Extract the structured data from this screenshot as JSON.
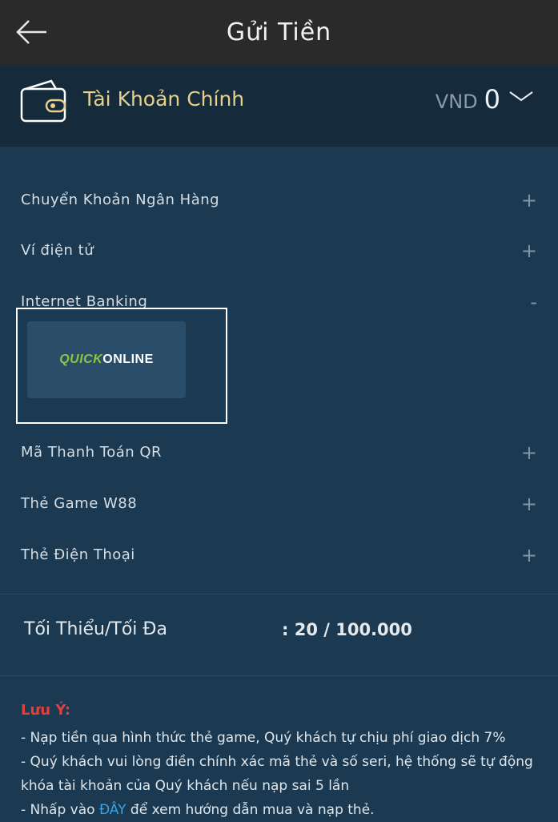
{
  "header": {
    "title": "Gửi Tiền",
    "back_icon": "arrow-left-icon"
  },
  "account": {
    "name": "Tài Khoản Chính",
    "currency": "VND",
    "balance": "0",
    "wallet_icon": "wallet-icon",
    "expand_icon": "chevron-down-icon"
  },
  "menu": {
    "items": [
      {
        "label": "Chuyển Khoản Ngân Hàng",
        "sign": "+"
      },
      {
        "label": "Ví điện tử",
        "sign": "+"
      },
      {
        "label": "Internet Banking",
        "sign": "-"
      },
      {
        "label": "Mã Thanh Toán QR",
        "sign": "+"
      },
      {
        "label": "Thẻ Game W88",
        "sign": "+"
      },
      {
        "label": "Thẻ Điện Thoại",
        "sign": "+"
      }
    ],
    "internet_banking_option": {
      "logo_part1": "QUICK",
      "logo_part2": "ONLINE"
    }
  },
  "limits": {
    "label": "Tối Thiểu/Tối Đa",
    "value": ": 20 / 100.000"
  },
  "notes": {
    "title": "Lưu Ý:",
    "line1": "- Nạp tiền qua hình thức thẻ game, Quý khách tự chịu phí giao dịch 7%",
    "line2": "- Quý khách vui lòng điền chính xác mã thẻ và số seri, hệ thống sẽ tự động khóa tài khoản của Quý khách nếu nạp sai 5 lần",
    "line3_prefix": "- Nhấp vào ",
    "line3_link": "ĐÂY",
    "line3_suffix": " để xem hướng dẫn mua và nạp thẻ."
  },
  "colors": {
    "background": "#1b3a52",
    "topbar": "#2a2a2a",
    "account_bar": "#152b3c",
    "account_name": "#e6d08a",
    "warning_title": "#e0403a",
    "link": "#3aa3e3",
    "logo_accent": "#8cc63f"
  }
}
